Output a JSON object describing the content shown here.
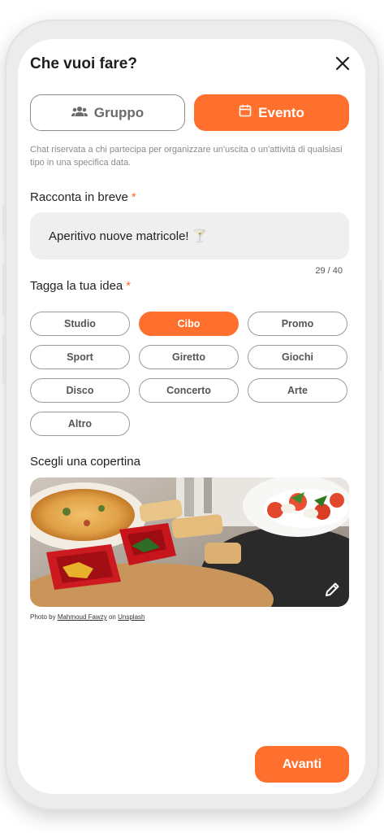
{
  "header": {
    "title": "Che vuoi fare?"
  },
  "type_toggle": {
    "gruppo_label": "Gruppo",
    "evento_label": "Evento",
    "selected": "Evento"
  },
  "description": "Chat riservata a chi partecipa per organizzare un'uscita o un'attività di qualsiasi tipo in una specifica data.",
  "summary": {
    "label": "Racconta in breve",
    "required_mark": "*",
    "value": "Aperitivo nuove matricole! 🍸",
    "counter": "29 / 40"
  },
  "tags": {
    "label": "Tagga la tua idea",
    "required_mark": "*",
    "items": [
      "Studio",
      "Cibo",
      "Promo",
      "Sport",
      "Giretto",
      "Giochi",
      "Disco",
      "Concerto",
      "Arte",
      "Altro"
    ],
    "selected": "Cibo"
  },
  "cover": {
    "label": "Scegli una copertina",
    "credit_prefix": "Photo by",
    "credit_author": "Mahmoud Fawzy",
    "credit_on": "on",
    "credit_source": "Unsplash"
  },
  "footer": {
    "next_label": "Avanti"
  },
  "colors": {
    "accent": "#ff6f2d",
    "input_bg": "#efefef",
    "muted_text": "#8a8a8a"
  },
  "icons": {
    "close": "close-icon",
    "group": "group-icon",
    "calendar": "calendar-icon",
    "edit": "pencil-icon"
  }
}
